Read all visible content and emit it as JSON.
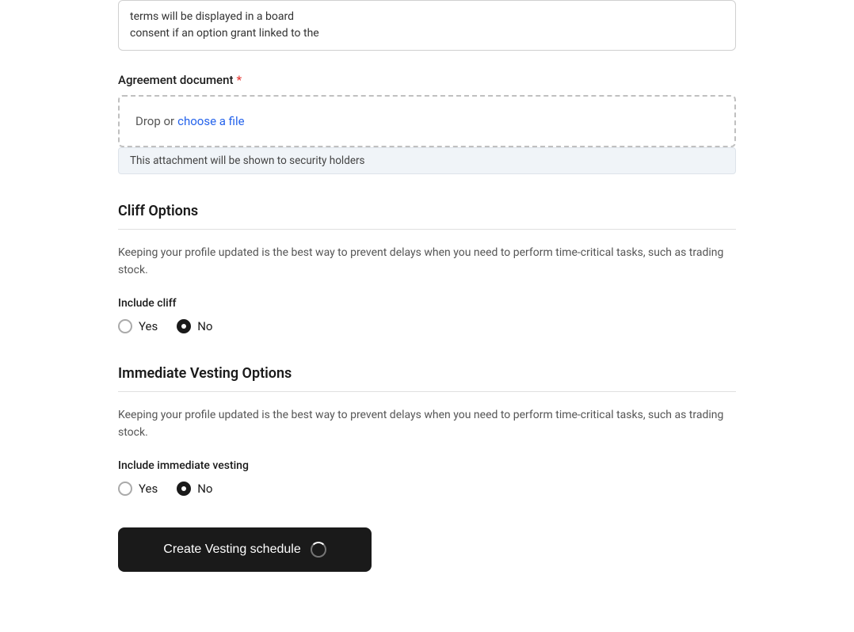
{
  "top_partial": {
    "line1": "terms will be displayed in a board",
    "line2": "consent if an option grant linked to the"
  },
  "agreement_document": {
    "label": "Agreement document",
    "required": true,
    "drop_zone": {
      "prefix_text": "Drop or ",
      "link_text": "choose a file"
    },
    "attachment_note": "This attachment will be shown to security holders"
  },
  "cliff_options": {
    "title": "Cliff Options",
    "description": "Keeping your profile updated is the best way to prevent delays when you need to perform time-critical tasks, such as trading stock.",
    "include_cliff_label": "Include cliff",
    "yes_label": "Yes",
    "no_label": "No",
    "selected": "no"
  },
  "immediate_vesting": {
    "title": "Immediate Vesting Options",
    "description": "Keeping your profile updated is the best way to prevent delays when you need to perform time-critical tasks, such as trading stock.",
    "include_label": "Include immediate vesting",
    "yes_label": "Yes",
    "no_label": "No",
    "selected": "no"
  },
  "submit_button": {
    "label": "Create Vesting schedule"
  },
  "colors": {
    "required_star": "#e53935",
    "link": "#2563eb",
    "button_bg": "#1a1a1a",
    "button_text": "#ffffff"
  }
}
